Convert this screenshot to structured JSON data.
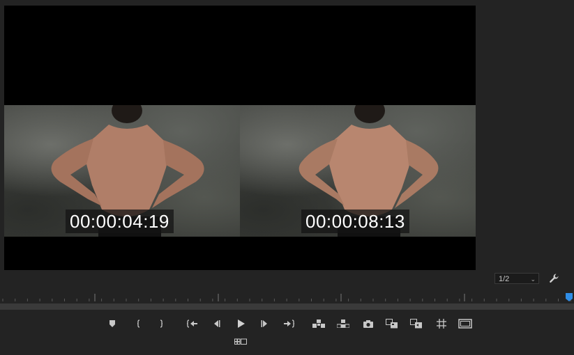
{
  "viewer": {
    "left_timecode": "00:00:04:19",
    "right_timecode": "00:00:08:13"
  },
  "controls": {
    "zoom_value": "1/2",
    "settings_icon": "wrench-icon",
    "buttons": [
      "add-marker-icon",
      "mark-in-icon",
      "mark-out-icon",
      "go-to-in-icon",
      "step-back-icon",
      "play-icon",
      "step-forward-icon",
      "go-to-out-icon",
      "insert-icon",
      "overwrite-icon",
      "export-frame-icon",
      "comparison-view-icon",
      "toggle-proxies-icon",
      "safe-margins-icon",
      "full-screen-icon",
      "multi-camera-icon"
    ]
  },
  "colors": {
    "accent": "#2f8de6",
    "panel": "#232323",
    "ruler": "#3a3a3a"
  }
}
